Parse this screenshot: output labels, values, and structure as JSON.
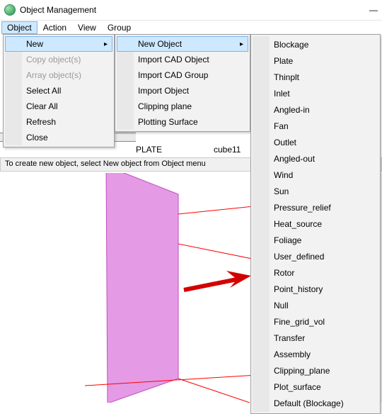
{
  "window": {
    "title": "Object Management",
    "min": "—"
  },
  "menubar": [
    "Object",
    "Action",
    "View",
    "Group"
  ],
  "menu1": {
    "items": [
      {
        "label": "New",
        "has_sub": true,
        "highlight": true,
        "disabled": false
      },
      {
        "label": "Copy object(s)",
        "has_sub": false,
        "highlight": false,
        "disabled": true
      },
      {
        "label": "Array object(s)",
        "has_sub": false,
        "highlight": false,
        "disabled": true
      },
      {
        "label": "Select All",
        "has_sub": false,
        "highlight": false,
        "disabled": false
      },
      {
        "label": "Clear All",
        "has_sub": false,
        "highlight": false,
        "disabled": false
      },
      {
        "label": "Refresh",
        "has_sub": false,
        "highlight": false,
        "disabled": false
      },
      {
        "label": "Close",
        "has_sub": false,
        "highlight": false,
        "disabled": false
      }
    ]
  },
  "menu2": {
    "items": [
      {
        "label": "New Object",
        "has_sub": true,
        "highlight": true
      },
      {
        "label": "Import CAD Object",
        "has_sub": false,
        "highlight": false
      },
      {
        "label": "Import CAD Group",
        "has_sub": false,
        "highlight": false
      },
      {
        "label": "Import Object",
        "has_sub": false,
        "highlight": false
      },
      {
        "label": "Clipping plane",
        "has_sub": false,
        "highlight": false
      },
      {
        "label": "Plotting Surface",
        "has_sub": false,
        "highlight": false
      }
    ]
  },
  "menu3": {
    "items": [
      "Blockage",
      "Plate",
      "Thinplt",
      "Inlet",
      "Angled-in",
      "Fan",
      "Outlet",
      "Angled-out",
      "Wind",
      "Sun",
      "Pressure_relief",
      "Heat_source",
      "Foliage",
      "User_defined",
      "Rotor",
      "Point_history",
      "Null",
      "Fine_grid_vol",
      "Transfer",
      "Assembly",
      "Clipping_plane",
      "Plot_surface",
      "Default (Blockage)"
    ]
  },
  "status": "To create new object, select New object from Object menu",
  "row": {
    "type": "PLATE",
    "name": "cube11"
  },
  "frag": "fr"
}
